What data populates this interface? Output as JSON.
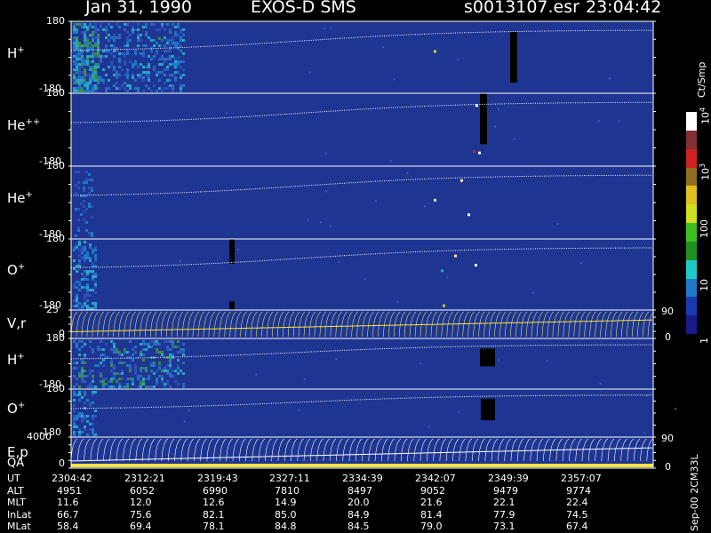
{
  "title": {
    "date": "Jan 31, 1990",
    "instrument": "EXOS-D SMS",
    "file": "s0013107.esr",
    "time": "23:04:42"
  },
  "colors": {
    "background": "#000000",
    "panel_bg": "#1e3591",
    "panel_border": "#ffffff",
    "trace": "#ffffff",
    "qa_bar": "#ffe23a"
  },
  "chart_data": [
    {
      "type": "heatmap",
      "panel": "H+ (1)",
      "label": "H",
      "sup": "+",
      "ylim": [
        -180,
        180
      ],
      "yticks": [
        "180",
        "-180"
      ]
    },
    {
      "type": "heatmap",
      "panel": "He++",
      "label": "He",
      "sup": "++",
      "ylim": [
        -180,
        180
      ],
      "yticks": [
        "180",
        "-180"
      ]
    },
    {
      "type": "heatmap",
      "panel": "He+",
      "label": "He",
      "sup": "+",
      "ylim": [
        -180,
        180
      ],
      "yticks": [
        "180",
        "-180"
      ]
    },
    {
      "type": "heatmap",
      "panel": "O+ (1)",
      "label": "O",
      "sup": "+",
      "ylim": [
        -180,
        180
      ],
      "yticks": [
        "180",
        "-180"
      ]
    },
    {
      "type": "line",
      "panel": "V,r",
      "label": "V,r",
      "sup": "",
      "ylim": [
        0,
        25
      ],
      "yticks": [
        "25",
        "0"
      ],
      "right_ticks": [
        "90",
        "0"
      ]
    },
    {
      "type": "heatmap",
      "panel": "H+ (2)",
      "label": "H",
      "sup": "+",
      "ylim": [
        -180,
        180
      ],
      "yticks": [
        "180",
        "-180"
      ]
    },
    {
      "type": "heatmap",
      "panel": "O+ (2)",
      "label": "O",
      "sup": "+",
      "ylim": [
        -180,
        180
      ],
      "yticks": [
        "180",
        "-180"
      ]
    },
    {
      "type": "line",
      "panel": "E,p",
      "label": "E,p",
      "sup": "",
      "label2": "QA",
      "ylim": [
        0,
        4000
      ],
      "yticks": [
        "4000",
        "0"
      ],
      "right_ticks": [
        "90",
        "0"
      ]
    }
  ],
  "colorbar": {
    "unit": "Ct/Smp",
    "ticks": [
      {
        "text": "1",
        "sup": "",
        "pos": 0.0
      },
      {
        "text": "10",
        "sup": "",
        "pos": 0.25
      },
      {
        "text": "100",
        "sup": "",
        "pos": 0.5
      },
      {
        "text": "10",
        "sup": "3",
        "pos": 0.75
      },
      {
        "text": "10",
        "sup": "4",
        "pos": 1.0
      }
    ],
    "stops": [
      "#1a1a8a",
      "#1a3ab0",
      "#1f78c8",
      "#20c8c8",
      "#209020",
      "#40c020",
      "#d0e020",
      "#e0c020",
      "#907020",
      "#d02020",
      "#803030",
      "#ffffff"
    ]
  },
  "table": {
    "labels": [
      "UT",
      "ALT",
      "MLT",
      "InLat",
      "MLat"
    ],
    "rows": [
      [
        "2304:42",
        "2312:21",
        "2319:43",
        "2327:11",
        "2334:39",
        "2342:07",
        "2349:39",
        "2357:07"
      ],
      [
        "4951",
        "6052",
        "6990",
        "7810",
        "8497",
        "9052",
        "9479",
        "9774"
      ],
      [
        "11.6",
        "12.0",
        "12.6",
        "14.9",
        "20.0",
        "21.6",
        "22.1",
        "22.4"
      ],
      [
        "66.7",
        "75.6",
        "82.1",
        "85.0",
        "84.9",
        "81.4",
        "77.9",
        "74.5"
      ],
      [
        "58.4",
        "69.4",
        "78.1",
        "84.8",
        "84.5",
        "79.0",
        "73.1",
        "67.4"
      ]
    ]
  },
  "footer": "Sep-00 2CM33L"
}
